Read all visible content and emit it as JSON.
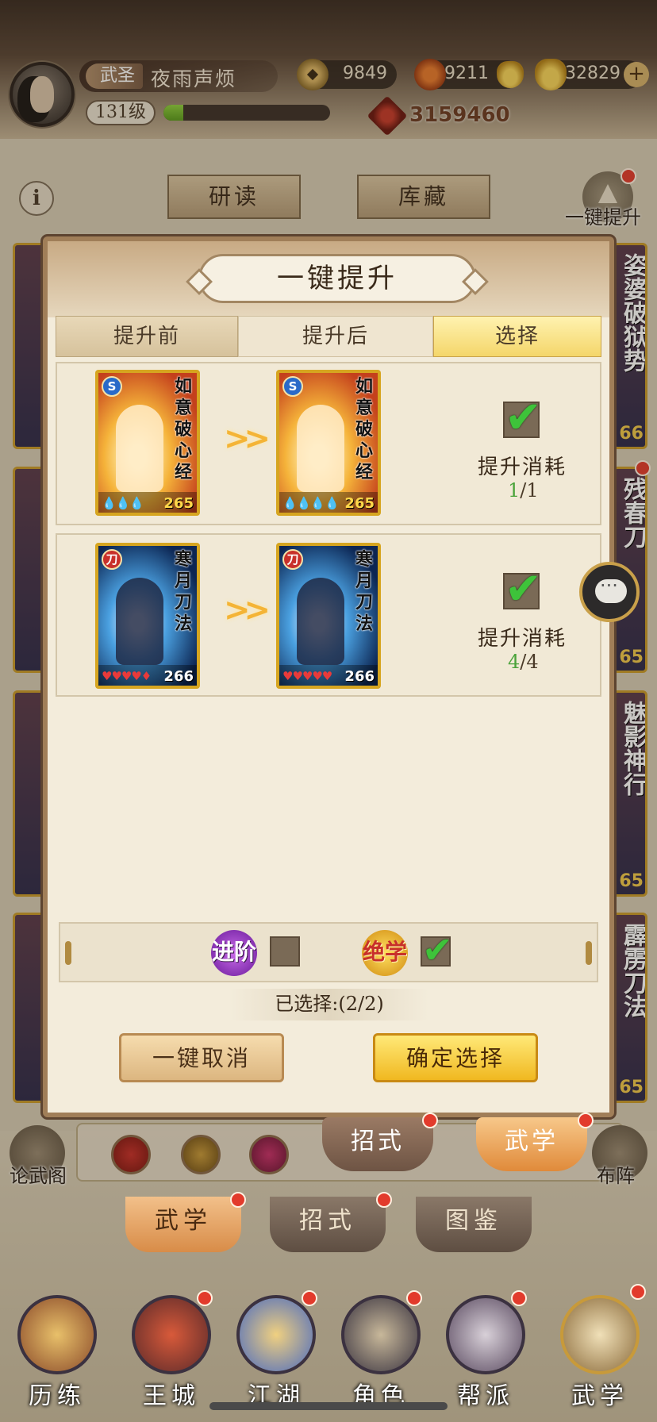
{
  "player": {
    "title": "武圣",
    "name": "夜雨声烦",
    "level": "131级",
    "exp_fraction": 0.12,
    "power": "3159460"
  },
  "currencies": [
    {
      "icon": "coin-icon",
      "value": "9849"
    },
    {
      "icon": "leaf-token-icon",
      "value": "9211"
    },
    {
      "icon": "gold-ingot-icon",
      "value": "32829"
    }
  ],
  "page": {
    "tabs": [
      "研读",
      "库藏"
    ],
    "upgrade_all_label": "一键提升",
    "left_cards": [
      "",
      "",
      "",
      ""
    ],
    "right_cards": [
      {
        "name": "姿婆破狱势",
        "level": "66"
      },
      {
        "name": "残春刀",
        "level": "65"
      },
      {
        "name": "魅影神行",
        "level": "65"
      },
      {
        "name": "霹雳刀法",
        "level": "65"
      }
    ],
    "bottom_left_label": "论武阁",
    "bottom_right_label": "布阵",
    "floating_tabs": [
      "招式",
      "武学"
    ],
    "sub_tabs": [
      "武学",
      "招式",
      "图鉴"
    ],
    "nav": [
      "历练",
      "王城",
      "江湖",
      "角色",
      "帮派",
      "武学"
    ]
  },
  "dialog": {
    "title": "一键提升",
    "columns": [
      "提升前",
      "提升后",
      "选择"
    ],
    "rows": [
      {
        "card_name": "如意破心经",
        "badge": "S",
        "level": "265",
        "gems_before": "💧💧💧",
        "gems_after": "💧💧💧💧",
        "checked": true,
        "cost_label": "提升消耗",
        "cost_have": "1",
        "cost_need": "/1"
      },
      {
        "card_name": "寒月刀法",
        "badge": "刀",
        "level": "266",
        "gems_before": "♥♥♥♥♦",
        "gems_after": "♥♥♥♥♥",
        "checked": true,
        "cost_label": "提升消耗",
        "cost_have": "4",
        "cost_need": "/4"
      }
    ],
    "filters": [
      {
        "label": "进阶",
        "checked": false
      },
      {
        "label": "绝学",
        "checked": true
      }
    ],
    "selected_count": "已选择:(2/2)",
    "cancel_button": "一键取消",
    "confirm_button": "确定选择"
  },
  "colors": {
    "accent_gold": "#f0b820",
    "check_green": "#3ec33a",
    "badge_red": "#e23b2c"
  }
}
